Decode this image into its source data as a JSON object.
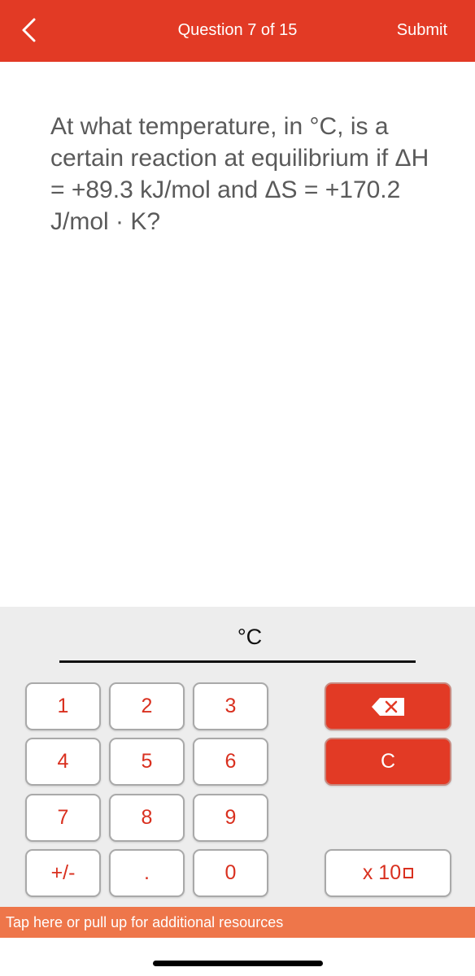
{
  "header": {
    "back_icon": "chevron-left-icon",
    "title": "Question 7 of 15",
    "submit_label": "Submit",
    "background_color": "#E23A25"
  },
  "question": {
    "text": "At what temperature, in °C, is a certain reaction at equilibrium if ΔH = +89.3 kJ/mol and ΔS = +170.2 J/mol · K?"
  },
  "answer": {
    "unit": "°C",
    "value": ""
  },
  "keypad": {
    "keys": [
      {
        "label": "1"
      },
      {
        "label": "2"
      },
      {
        "label": "3"
      },
      {
        "label": "4"
      },
      {
        "label": "5"
      },
      {
        "label": "6"
      },
      {
        "label": "7"
      },
      {
        "label": "8"
      },
      {
        "label": "9"
      },
      {
        "label": "+/-"
      },
      {
        "label": "."
      },
      {
        "label": "0"
      }
    ],
    "backspace_icon": "backspace-icon",
    "clear_label": "C",
    "exponent_label": "x 10",
    "key_text_color": "#D9301F",
    "action_color": "#E23A25"
  },
  "resources": {
    "label": "Tap here or pull up for additional resources",
    "color": "#EE764A"
  }
}
